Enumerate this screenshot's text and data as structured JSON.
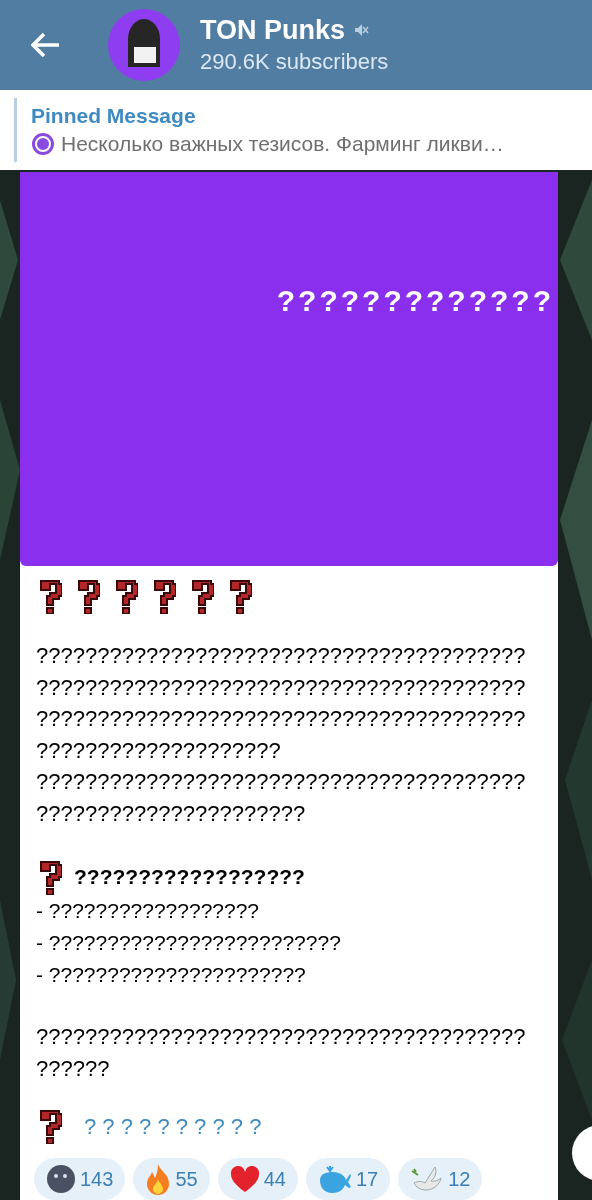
{
  "header": {
    "title": "TON Punks",
    "muted": true,
    "subtitle": "290.6K subscribers"
  },
  "pinned": {
    "label": "Pinned Message",
    "text": "Несколько важных тезисов. Фарминг ликви…"
  },
  "post": {
    "banner_text": "?????????????",
    "body_lines": [
      "????????????????????????????????????????",
      "????????????????????????????????????????",
      "????????????????????????????????????????",
      "????????????????????",
      "????????????????????????????????????????",
      "??????????????????????"
    ],
    "heading": "??????????????????",
    "list_items": [
      "- ??????????????????",
      "- ?????????????????????????",
      "- ??????????????????????"
    ],
    "closing_lines": [
      "????????????????????????????????????????",
      "??????"
    ],
    "link": "? ? ? ? ? ? ? ? ? ?",
    "reactions": [
      {
        "kind": "moon",
        "count": "143"
      },
      {
        "kind": "fire",
        "count": "55"
      },
      {
        "kind": "heart",
        "count": "44"
      },
      {
        "kind": "whale",
        "count": "17"
      },
      {
        "kind": "dove",
        "count": "12"
      }
    ]
  }
}
